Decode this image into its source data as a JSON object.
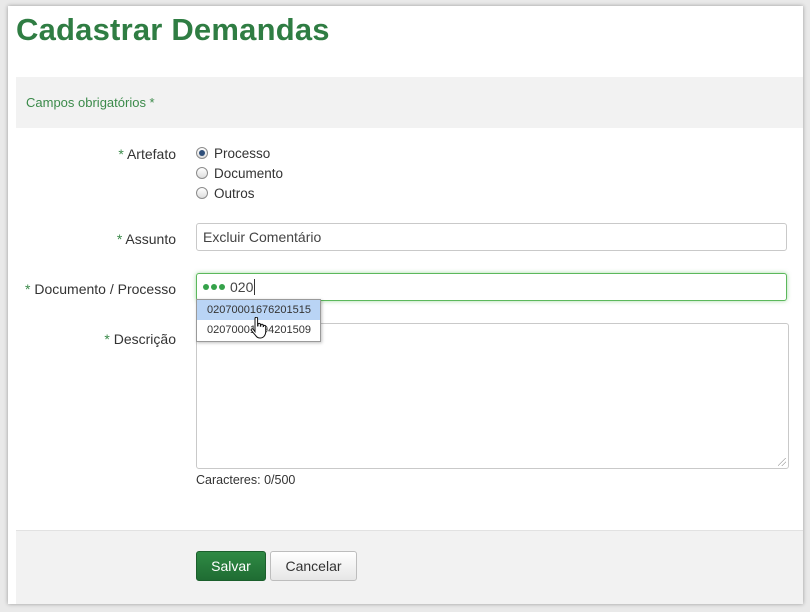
{
  "header": {
    "title": "Cadastrar Demandas"
  },
  "form": {
    "required_note": "Campos obrigatórios *",
    "required_mark": "*",
    "artefato": {
      "label": "Artefato",
      "options": [
        {
          "label": "Processo",
          "checked": true
        },
        {
          "label": "Documento",
          "checked": false
        },
        {
          "label": "Outros",
          "checked": false
        }
      ]
    },
    "assunto": {
      "label": "Assunto",
      "value": "Excluir Comentário"
    },
    "documento": {
      "label": "Documento / Processo",
      "value": "020",
      "suggestions": [
        "02070001676201515",
        "02070001594201509"
      ],
      "icon": "loading-dots-icon"
    },
    "descricao": {
      "label": "Descrição",
      "value": ""
    },
    "counter": "Caracteres: 0/500"
  },
  "footer": {
    "save_label": "Salvar",
    "cancel_label": "Cancelar"
  },
  "colors": {
    "accent": "#2f7d43",
    "focus": "#5cb85c",
    "highlight": "#b9d4f5"
  }
}
